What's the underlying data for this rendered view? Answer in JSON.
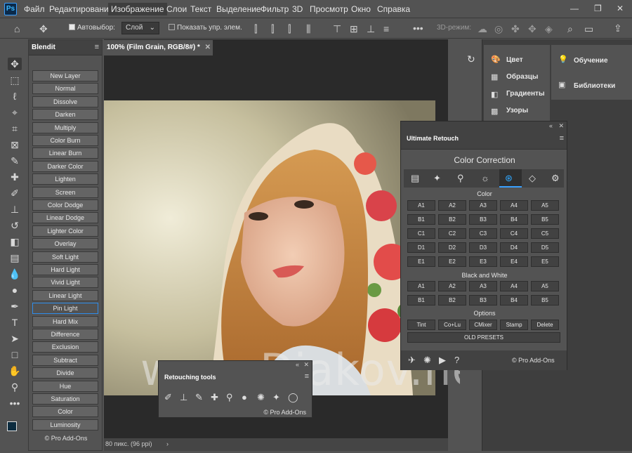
{
  "app": {
    "logo": "Ps"
  },
  "menu": [
    "Файл",
    "Редактирование",
    "Изображение",
    "Слои",
    "Текст",
    "Выделение",
    "Фильтр",
    "3D",
    "Просмотр",
    "Окно",
    "Справка"
  ],
  "options": {
    "autoselect_label": "Автовыбор:",
    "autoselect_value": "Слой",
    "show_controls": "Показать упр. элем.",
    "mode3d": "3D-режим:"
  },
  "document": {
    "tab_title": "100% (Film Grain, RGB/8#) *",
    "status": "80 пикс. (96 ppi)"
  },
  "blendit": {
    "title": "Blendit",
    "modes": [
      "New Layer",
      "Normal",
      "Dissolve",
      "Darken",
      "Multiply",
      "Color Burn",
      "Linear Burn",
      "Darker Color",
      "Lighten",
      "Screen",
      "Color Dodge",
      "Linear Dodge",
      "Lighter Color",
      "Overlay",
      "Soft Light",
      "Hard Light",
      "Vivid Light",
      "Linear Light",
      "Pin Light",
      "Hard Mix",
      "Difference",
      "Exclusion",
      "Subtract",
      "Divide",
      "Hue",
      "Saturation",
      "Color",
      "Luminosity"
    ],
    "footer": "© Pro Add-Ons"
  },
  "right_panels": {
    "col1": [
      "Цвет",
      "Образцы",
      "Градиенты",
      "Узоры"
    ],
    "col2": [
      "Обучение",
      "Библиотеки"
    ]
  },
  "ultimate_retouch": {
    "title": "Ultimate Retouch",
    "heading": "Color Correction",
    "color_label": "Color",
    "color_grid": [
      [
        "A1",
        "A2",
        "A3",
        "A4",
        "A5"
      ],
      [
        "B1",
        "B2",
        "B3",
        "B4",
        "B5"
      ],
      [
        "C1",
        "C2",
        "C3",
        "C4",
        "C5"
      ],
      [
        "D1",
        "D2",
        "D3",
        "D4",
        "D5"
      ],
      [
        "E1",
        "E2",
        "E3",
        "E4",
        "E5"
      ]
    ],
    "bw_label": "Black and White",
    "bw_grid": [
      [
        "A1",
        "A2",
        "A3",
        "A4",
        "A5"
      ],
      [
        "B1",
        "B2",
        "B3",
        "B4",
        "B5"
      ]
    ],
    "options_label": "Options",
    "options": [
      "Tint",
      "Co+Lu",
      "CMixer",
      "Stamp",
      "Delete"
    ],
    "old_presets": "OLD PRESETS",
    "footer": "© Pro Add-Ons"
  },
  "retouching_tools": {
    "title": "Retouching tools",
    "footer": "© Pro Add-Ons"
  },
  "watermark": "www.Diakov.net"
}
